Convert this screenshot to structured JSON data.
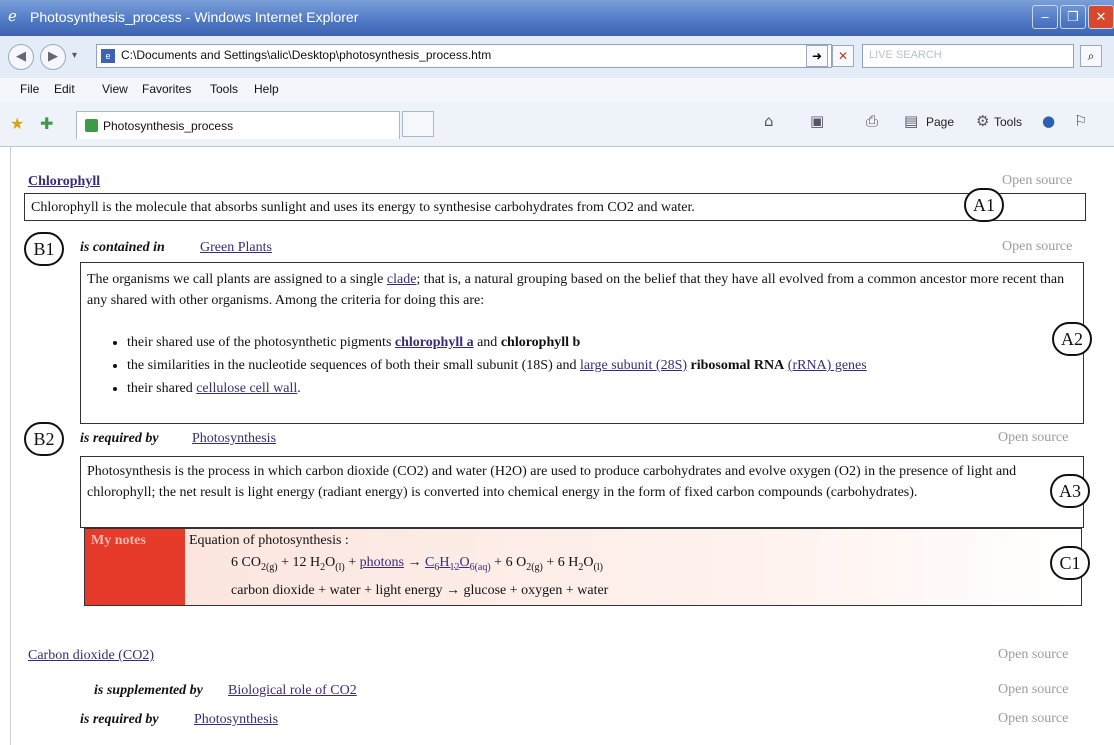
{
  "browser": {
    "window_title": "Photosynthesis_process - Windows Internet Explorer",
    "address": "C:\\Documents and Settings\\alic\\Desktop\\photosynthesis_process.htm",
    "search_placeholder": "LIVE SEARCH",
    "menu": [
      "File",
      "Edit",
      "View",
      "Favorites",
      "Tools",
      "Help"
    ],
    "tab_title": "Photosynthesis_process",
    "commands": {
      "page": "Page",
      "tools": "Tools"
    }
  },
  "page": {
    "open_source_label": "Open source",
    "chlorophyll": {
      "title": "Chlorophyll",
      "definition": "Chlorophyll is the molecule that absorbs sunlight and uses its energy to synthesise carbohydrates from CO2 and water."
    },
    "relation1": {
      "label": "is contained in",
      "target": "Green Plants",
      "text_a": "The organisms we call plants are assigned to a single",
      "link_clade": "clade",
      "text_b": "; that is, a natural grouping based on the belief that they have all evolved from a common ancestor more recent than any shared with other organisms. Among the criteria for doing this are:",
      "bullets": {
        "b1_text": "their shared use of the photosynthetic pigments",
        "b1_link": "chlorophyll a",
        "b1_and": "and",
        "b1_bold": "chlorophyll b",
        "b2_text": "the similarities in the nucleotide sequences of both their small subunit (18S) and",
        "b2_link": "large subunit (28S)",
        "b2_bold": "ribosomal RNA",
        "b2_link2": "(rRNA) genes",
        "b3_text": "their shared",
        "b3_link": "cellulose cell wall",
        "b3_end": "."
      }
    },
    "relation2": {
      "label": "is required by",
      "target": "Photosynthesis",
      "text": "Photosynthesis is the process in which carbon dioxide (CO2) and water (H2O) are used to produce  carbohydrates and evolve oxygen (O2) in the presence of light and chlorophyll; the net result is light energy (radiant energy) is converted into chemical energy in the form of fixed carbon compounds (carbohydrates)."
    },
    "notes": {
      "tag": "My notes",
      "heading": "Equation of photosynthesis :",
      "eq": {
        "a": "6 CO",
        "a_sub": "2(g)",
        "b": " + 12 H",
        "b_sub1": "2",
        "b2": "O",
        "b_sub2": "(l)",
        "c": " + ",
        "photons": "photons",
        "arrow": " → ",
        "d": "C",
        "d_sub1": "6",
        "d2": "H",
        "d_sub2": "12",
        "d3": "O",
        "d_sub3": "6(aq)",
        "e": " + 6 O",
        "e_sub": "2(g)",
        "f": " + 6 H",
        "f_sub1": "2",
        "f2": "O",
        "f_sub2": "(l)"
      },
      "words": "carbon dioxide + water + light energy → glucose + oxygen + water"
    },
    "co2": {
      "title": "Carbon dioxide (CO2)",
      "rel1_label": "is supplemented by",
      "rel1_target": "Biological role of CO2",
      "rel2_label": "is required by",
      "rel2_target": "Photosynthesis"
    },
    "annotations": {
      "a1": "A1",
      "a2": "A2",
      "a3": "A3",
      "b1": "B1",
      "b2": "B2",
      "c1": "C1"
    }
  }
}
